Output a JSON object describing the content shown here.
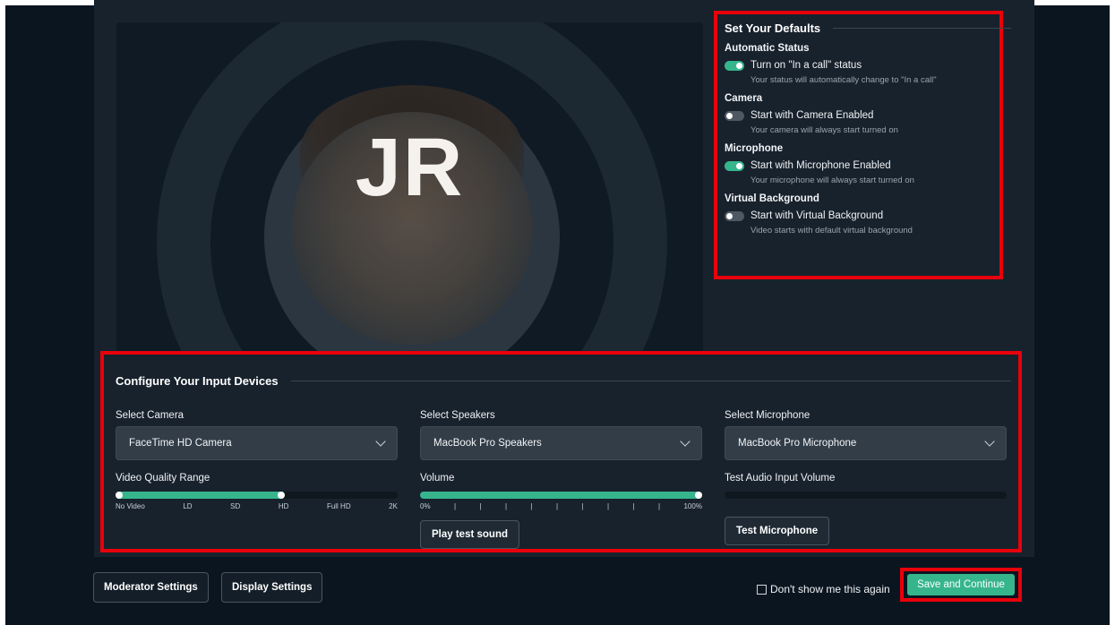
{
  "preview": {
    "initials": "JR"
  },
  "defaults": {
    "title": "Set Your Defaults",
    "groups": [
      {
        "heading": "Automatic Status",
        "label": "Turn on \"In a call\" status",
        "desc": "Your status will automatically change to \"In a call\"",
        "on": true
      },
      {
        "heading": "Camera",
        "label": "Start with Camera Enabled",
        "desc": "Your camera will always start turned on",
        "on": false
      },
      {
        "heading": "Microphone",
        "label": "Start with Microphone Enabled",
        "desc": "Your microphone will always start turned on",
        "on": true
      },
      {
        "heading": "Virtual Background",
        "label": "Start with Virtual Background",
        "desc": "Video starts with default virtual background",
        "on": false
      }
    ]
  },
  "devices": {
    "title": "Configure Your Input Devices",
    "camera": {
      "label": "Select Camera",
      "value": "FaceTime HD Camera"
    },
    "speakers": {
      "label": "Select Speakers",
      "value": "MacBook Pro Speakers"
    },
    "microphone": {
      "label": "Select Microphone",
      "value": "MacBook Pro Microphone"
    },
    "video_quality": {
      "label": "Video Quality Range",
      "ticks": [
        "No Video",
        "LD",
        "SD",
        "HD",
        "Full HD",
        "2K"
      ],
      "selected_fraction": 0.6
    },
    "volume": {
      "label": "Volume",
      "min_label": "0%",
      "max_label": "100%",
      "level_fraction": 1.0
    },
    "test_audio": {
      "label": "Test Audio Input Volume",
      "level_fraction": 0.0
    },
    "play_test_sound": "Play test sound",
    "test_microphone": "Test Microphone"
  },
  "footer": {
    "moderator_settings": "Moderator Settings",
    "display_settings": "Display Settings",
    "dont_show": "Don't show me this again",
    "save_continue": "Save and Continue"
  },
  "colors": {
    "accent": "#36b58d",
    "highlight": "#e8000b",
    "panel": "#18222d"
  }
}
